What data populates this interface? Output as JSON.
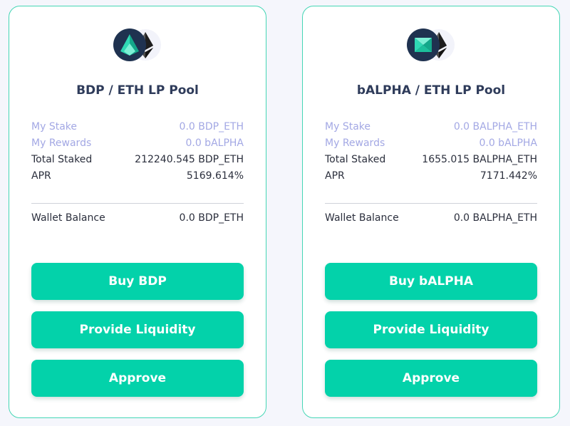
{
  "colors": {
    "accent": "#03d2aa",
    "card_border": "#45d6b5",
    "title": "#2e3b5a",
    "highlight_text": "#a3a8e4",
    "page_bg": "#f5f6fc"
  },
  "pools": [
    {
      "title": "BDP / ETH LP Pool",
      "token_icon": "bdp-token-icon",
      "stats": {
        "my_stake_label": "My Stake",
        "my_stake_value": "0.0 BDP_ETH",
        "my_rewards_label": "My Rewards",
        "my_rewards_value": "0.0 bALPHA",
        "total_staked_label": "Total Staked",
        "total_staked_value": "212240.545 BDP_ETH",
        "apr_label": "APR",
        "apr_value": "5169.614%"
      },
      "wallet_label": "Wallet Balance",
      "wallet_value": "0.0 BDP_ETH",
      "buttons": {
        "buy": "Buy BDP",
        "liquidity": "Provide Liquidity",
        "approve": "Approve"
      }
    },
    {
      "title": "bALPHA / ETH LP Pool",
      "token_icon": "balpha-token-icon",
      "stats": {
        "my_stake_label": "My Stake",
        "my_stake_value": "0.0 BALPHA_ETH",
        "my_rewards_label": "My Rewards",
        "my_rewards_value": "0.0 bALPHA",
        "total_staked_label": "Total Staked",
        "total_staked_value": "1655.015 BALPHA_ETH",
        "apr_label": "APR",
        "apr_value": "7171.442%"
      },
      "wallet_label": "Wallet Balance",
      "wallet_value": "0.0 BALPHA_ETH",
      "buttons": {
        "buy": "Buy bALPHA",
        "liquidity": "Provide Liquidity",
        "approve": "Approve"
      }
    }
  ]
}
